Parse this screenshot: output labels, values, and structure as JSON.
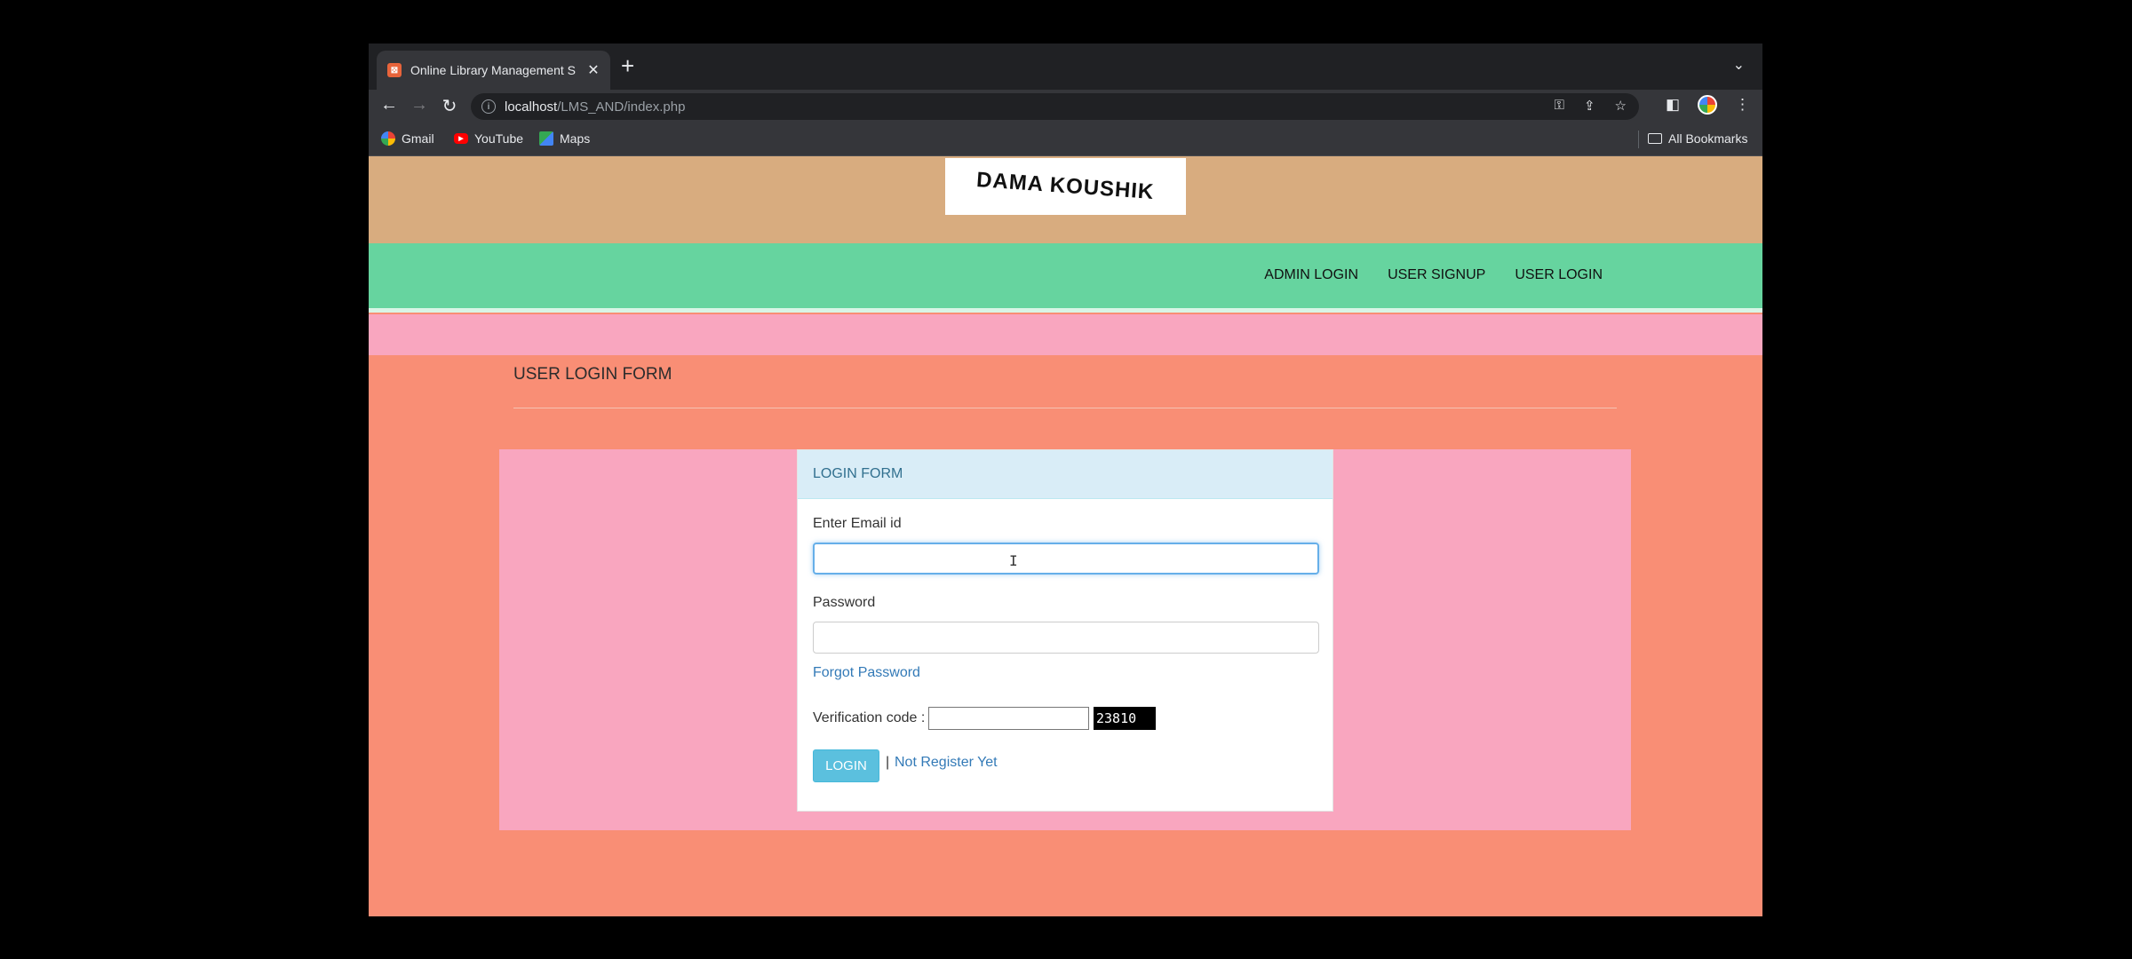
{
  "browser": {
    "tab_title": "Online Library Management S",
    "tab_close": "✕",
    "new_tab": "+",
    "url_host": "localhost",
    "url_path": "/LMS_AND/index.php",
    "bookmarks": [
      {
        "label": "Gmail",
        "icon": "gmail-icon"
      },
      {
        "label": "YouTube",
        "icon": "youtube-icon"
      },
      {
        "label": "Maps",
        "icon": "maps-icon"
      }
    ],
    "all_bookmarks": "All Bookmarks"
  },
  "site": {
    "logo_text": "DAMA KOUSHIK",
    "nav": [
      "ADMIN LOGIN",
      "USER SIGNUP",
      "USER LOGIN"
    ],
    "page_heading": "USER LOGIN FORM"
  },
  "form": {
    "card_title": "LOGIN FORM",
    "email_label": "Enter Email id",
    "email_value": "",
    "password_label": "Password",
    "password_value": "",
    "forgot_password": "Forgot Password",
    "verification_label": "Verification code :",
    "verification_value": "",
    "captcha_code": "23810",
    "login_button": "LOGIN",
    "separator": "|",
    "not_registered": "Not Register Yet"
  },
  "colors": {
    "header_bg": "#d8ac7f",
    "navbar_bg": "#66d49f",
    "pink_band": "#f9a6bf",
    "page_bg": "#f98e75",
    "card_head_bg": "#d9edf7",
    "login_button_bg": "#5bc0de"
  }
}
